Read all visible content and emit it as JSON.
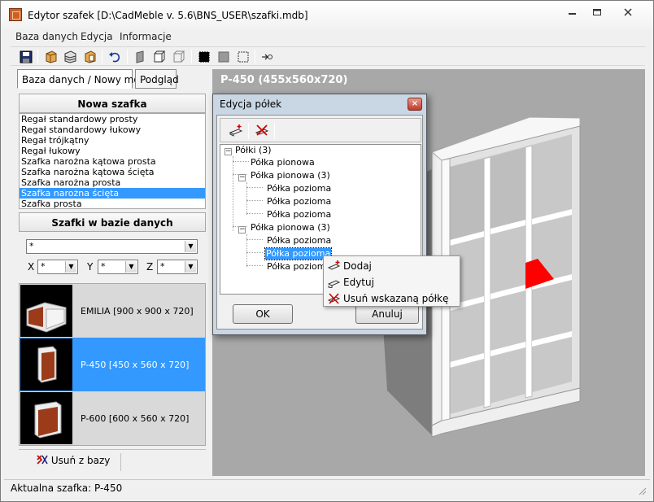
{
  "window": {
    "title": "Edytor szafek [D:\\CadMeble v. 5.6\\BNS_USER\\szafki.mdb]",
    "controls": [
      "minimize",
      "maximize",
      "close"
    ]
  },
  "menu": [
    "Baza danych",
    "Edycja",
    "Informacje"
  ],
  "toolbar_icons": [
    "save-icon",
    "cabinet-front-icon",
    "cabinet-open-icon",
    "cabinet-side-icon",
    "undo-icon",
    "panel-gray-icon",
    "cube-icon",
    "cube-outline-icon",
    "fill-black-icon",
    "fill-gray-icon",
    "fill-none-icon",
    "rotate-icon"
  ],
  "tabs": [
    "Baza danych / Nowy model",
    "Podgląd"
  ],
  "new_cabinet": {
    "heading": "Nowa szafka",
    "items": [
      "Regał standardowy prosty",
      "Regał standardowy łukowy",
      "Regał trójkątny",
      "Regał łukowy",
      "Szafka narożna kątowa prosta",
      "Szafka narożna kątowa ścięta",
      "Szafka narożna prosta",
      "Szafka narożna ścięta",
      "Szafka prosta"
    ],
    "selected_index": 7
  },
  "db_cabinets": {
    "heading": "Szafki w bazie danych",
    "filter": "*",
    "x_label": "X",
    "x_value": "*",
    "y_label": "Y",
    "y_value": "*",
    "z_label": "Z",
    "z_value": "*",
    "items": [
      {
        "label": "EMILIA  [900 x 900 x 720]"
      },
      {
        "label": "P-450  [450 x 560 x 720]"
      },
      {
        "label": "P-600  [600 x 560 x 720]"
      }
    ],
    "selected_index": 1,
    "delete_label": "Usuń z bazy"
  },
  "viewport": {
    "title": "P-450  (455x560x720)"
  },
  "status": "Aktualna szafka: P-450",
  "dialog": {
    "title": "Edycja półek",
    "close": "×",
    "tree": {
      "root": "Półki (3)",
      "n1": "Półka pionowa",
      "n2": "Półka pionowa (3)",
      "n2a": "Półka pozioma",
      "n2b": "Półka pozioma",
      "n2c": "Półka pozioma",
      "n3": "Półka pionowa (3)",
      "n3a": "Półka pozioma",
      "n3b": "Półka pozioma",
      "n3c": "Półka pozioma"
    },
    "ok": "OK",
    "cancel": "Anuluj"
  },
  "context_menu": [
    "Dodaj",
    "Edytuj",
    "Usuń wskazaną półkę"
  ],
  "colors": {
    "selection": "#3399ff",
    "viewport_bg": "#a8a8a8",
    "highlight_shelf": "#ff0000",
    "cabinet_wood": "#9b3b1a"
  }
}
